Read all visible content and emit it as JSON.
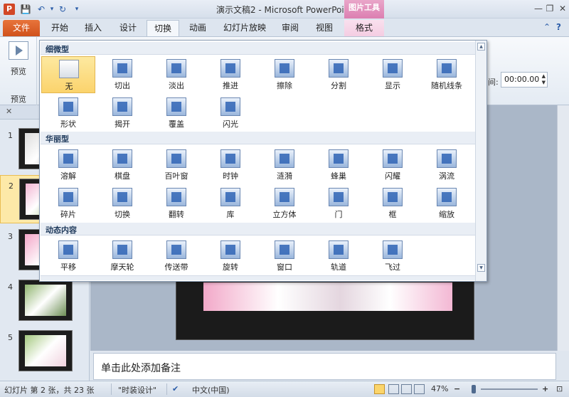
{
  "window": {
    "app_letter": "P",
    "title": "演示文稿2 - Microsoft PowerPoint",
    "context_tab_group": "图片工具",
    "minimize": "—",
    "restore": "❐",
    "close": "✕"
  },
  "quick_access": {
    "save": "💾",
    "undo": "↶",
    "undo_drop": "▾",
    "redo": "↻",
    "customize": "▾"
  },
  "tabs": [
    {
      "label": "文件"
    },
    {
      "label": "开始"
    },
    {
      "label": "插入"
    },
    {
      "label": "设计"
    },
    {
      "label": "切换"
    },
    {
      "label": "动画"
    },
    {
      "label": "幻灯片放映"
    },
    {
      "label": "审阅"
    },
    {
      "label": "视图"
    },
    {
      "label": "格式"
    }
  ],
  "tabs_right": {
    "minimize_ribbon": "⌃",
    "help": "?"
  },
  "ribbon": {
    "preview_button_label": "预览",
    "preview_group_label": "预览",
    "timing_label": "间:",
    "timing_value": "00:00.00",
    "spin_up": "▲",
    "spin_down": "▼"
  },
  "gallery": {
    "categories": [
      "细微型",
      "华丽型",
      "动态内容"
    ],
    "subtle": [
      "无",
      "切出",
      "淡出",
      "推进",
      "擦除",
      "分割",
      "显示",
      "随机线条",
      "形状",
      "揭开",
      "覆盖",
      "闪光"
    ],
    "exciting": [
      "溶解",
      "棋盘",
      "百叶窗",
      "时钟",
      "涟漪",
      "蜂巢",
      "闪耀",
      "涡流",
      "碎片",
      "切换",
      "翻转",
      "库",
      "立方体",
      "门",
      "框",
      "缩放"
    ],
    "dynamic": [
      "平移",
      "摩天轮",
      "传送带",
      "旋转",
      "窗口",
      "轨道",
      "飞过"
    ],
    "scroll_up": "▲",
    "scroll_down": "▼"
  },
  "slides": [
    {
      "num": "1"
    },
    {
      "num": "2"
    },
    {
      "num": "3"
    },
    {
      "num": "4"
    },
    {
      "num": "5"
    }
  ],
  "pane_close": "✕",
  "notes_placeholder": "单击此处添加备注",
  "status": {
    "slide_info": "幻灯片 第 2 张，共 23 张",
    "theme": "\"时装设计\"",
    "language": "中文(中国)",
    "zoom": "47%",
    "zoom_minus": "−",
    "zoom_plus": "+"
  }
}
